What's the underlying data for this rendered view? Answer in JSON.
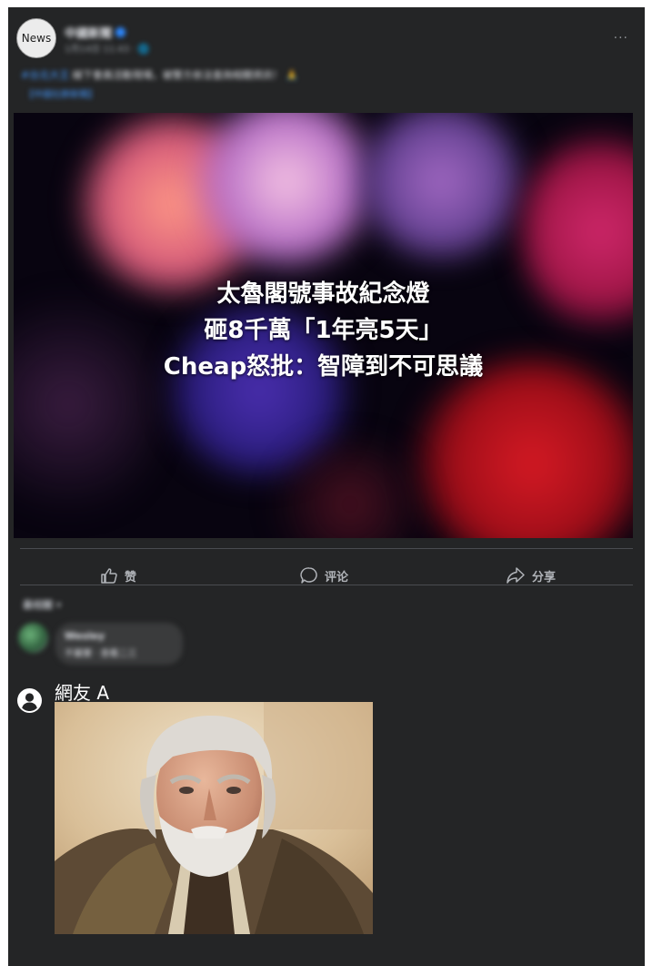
{
  "post": {
    "avatar_label": "News",
    "page_name": "中國新聞",
    "meta": "1月14日 11:43 · 🌐",
    "caption_highlight": "#台北大王",
    "caption_text": " 線下會員活動現場，被警方依法查詢相關資訊！ 🙏",
    "caption_link": "【中國社群新聞】",
    "more": "···"
  },
  "hero": {
    "line1": "太魯閣號事故紀念燈",
    "line2": "砸8千萬「1年亮5天」",
    "line3": "Cheap怒批：智障到不可思議"
  },
  "actions": {
    "like": "赞",
    "comment": "评论",
    "share": "分享"
  },
  "comments": {
    "sort_label": "最相關 ▾",
    "first": {
      "name": "Wesley",
      "text": "不屬實 · 查看二三"
    },
    "second": {
      "name": "網友 A"
    }
  },
  "colors": {
    "card_bg": "#242526",
    "text": "#e4e6eb",
    "muted": "#b0b3b8",
    "link": "#4599ff"
  }
}
